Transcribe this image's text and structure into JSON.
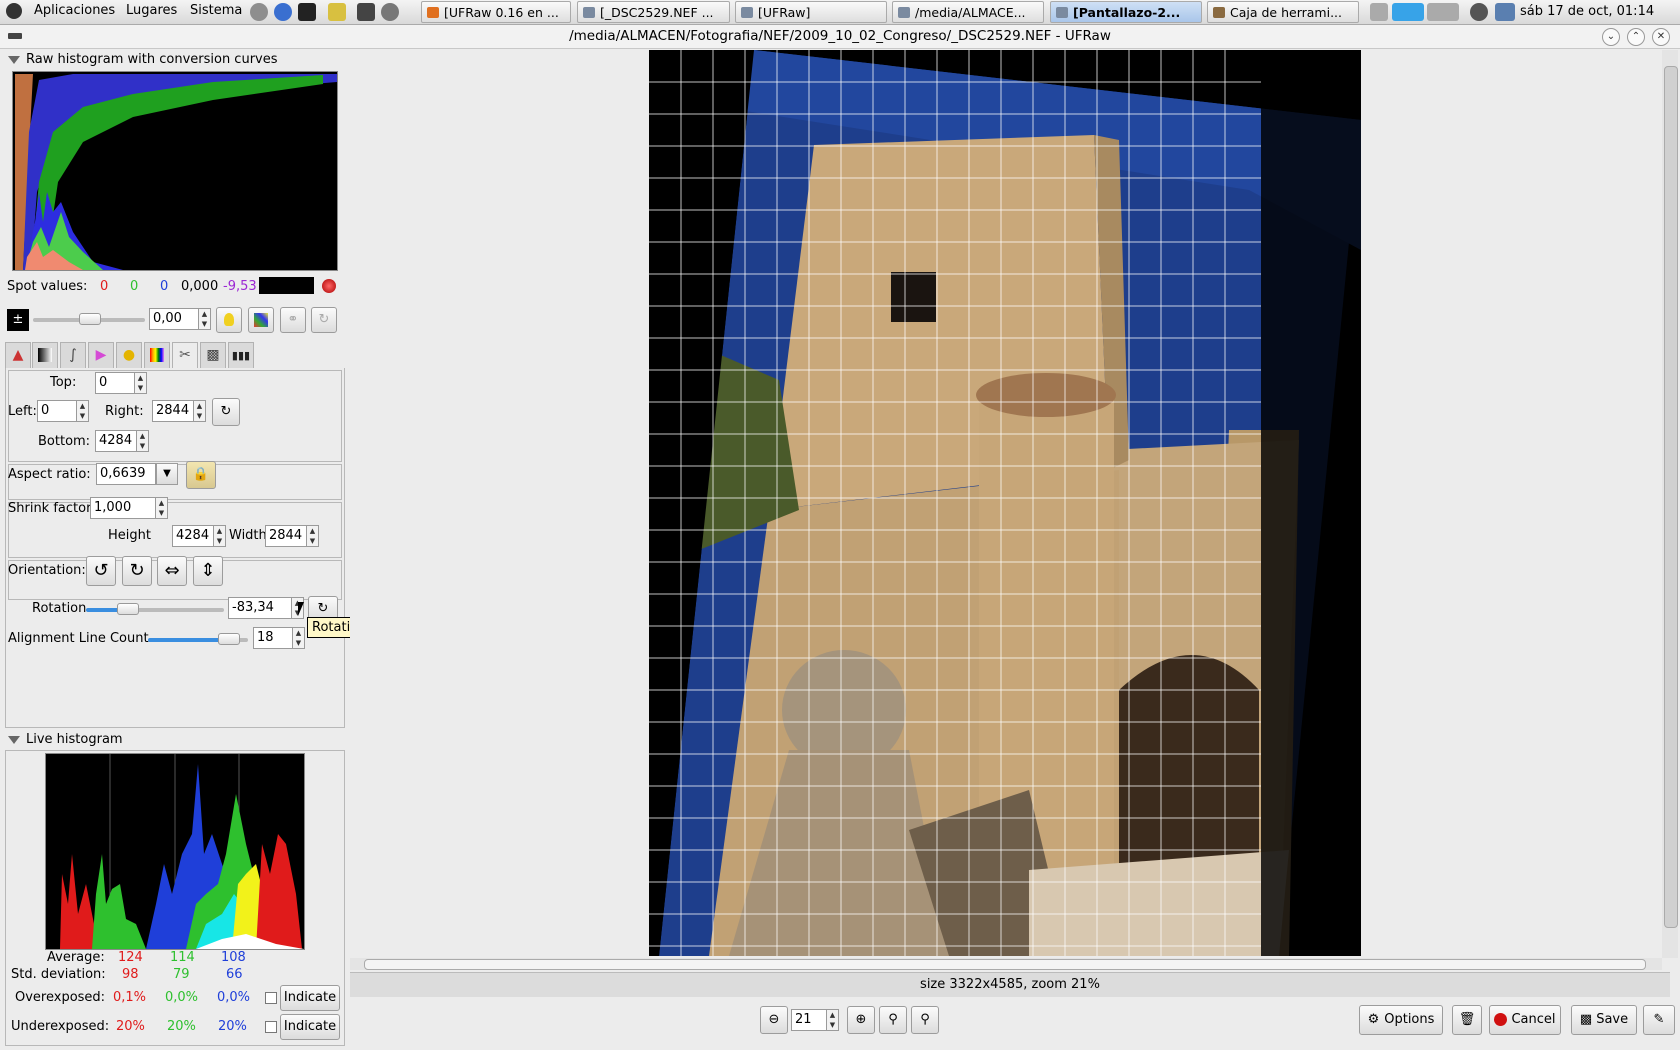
{
  "panel": {
    "menus": [
      "Aplicaciones",
      "Lugares",
      "Sistema"
    ],
    "tasks": [
      {
        "label": "[UFRaw 0.16 en ...",
        "active": false
      },
      {
        "label": "[_DSC2529.NEF ...",
        "active": false
      },
      {
        "label": "[UFRaw]",
        "active": false
      },
      {
        "label": "/media/ALMACE...",
        "active": false
      },
      {
        "label": "[Pantallazo-2...",
        "active": true
      },
      {
        "label": "Caja de herrami...",
        "active": false
      }
    ],
    "clock": "sáb 17 de oct, 01:14"
  },
  "window": {
    "title": "/media/ALMACEN/Fotografia/NEF/2009_10_02_Congreso/_DSC2529.NEF - UFRaw"
  },
  "raw_histogram": {
    "label": "Raw histogram with conversion curves"
  },
  "spot": {
    "label": "Spot values:",
    "r": "0",
    "g": "0",
    "b": "0",
    "lum": "0,000",
    "ev": "-9,53"
  },
  "exposure": {
    "value": "0,00",
    "slider_level": 0.5
  },
  "crop": {
    "top_label": "Top:",
    "top": "0",
    "left_label": "Left:",
    "left": "0",
    "right_label": "Right:",
    "right": "2844",
    "bottom_label": "Bottom:",
    "bottom": "4284",
    "aspect_label": "Aspect ratio:",
    "aspect": "0,6639",
    "shrink_label": "Shrink factor",
    "shrink": "1,000",
    "height_label": "Height",
    "height": "4284",
    "width_label": "Width",
    "width": "2844",
    "orientation_label": "Orientation:",
    "rotation_label": "Rotation",
    "rotation": "-83,34",
    "rotation_level": 0.27,
    "alignment_label": "Alignment Line Count",
    "alignment": "18",
    "alignment_level": 0.85
  },
  "tooltip": "Rotation Angle",
  "live_histogram": {
    "label": "Live histogram",
    "average_label": "Average:",
    "avg_r": "124",
    "avg_g": "114",
    "avg_b": "108",
    "std_label": "Std. deviation:",
    "std_r": "98",
    "std_g": "79",
    "std_b": "66",
    "over_label": "Overexposed:",
    "over_r": "0,1%",
    "over_g": "0,0%",
    "over_b": "0,0%",
    "under_label": "Underexposed:",
    "under_r": "20%",
    "under_g": "20%",
    "under_b": "20%",
    "indicate": "Indicate"
  },
  "status": "size 3322x4585, zoom 21%",
  "zoom": {
    "value": "21"
  },
  "buttons": {
    "options": "Options",
    "cancel": "Cancel",
    "save": "Save"
  },
  "colors": {
    "red": "#e01b1b",
    "green": "#2ec02e",
    "blue": "#1f3fd9",
    "purple": "#9c27d4"
  }
}
